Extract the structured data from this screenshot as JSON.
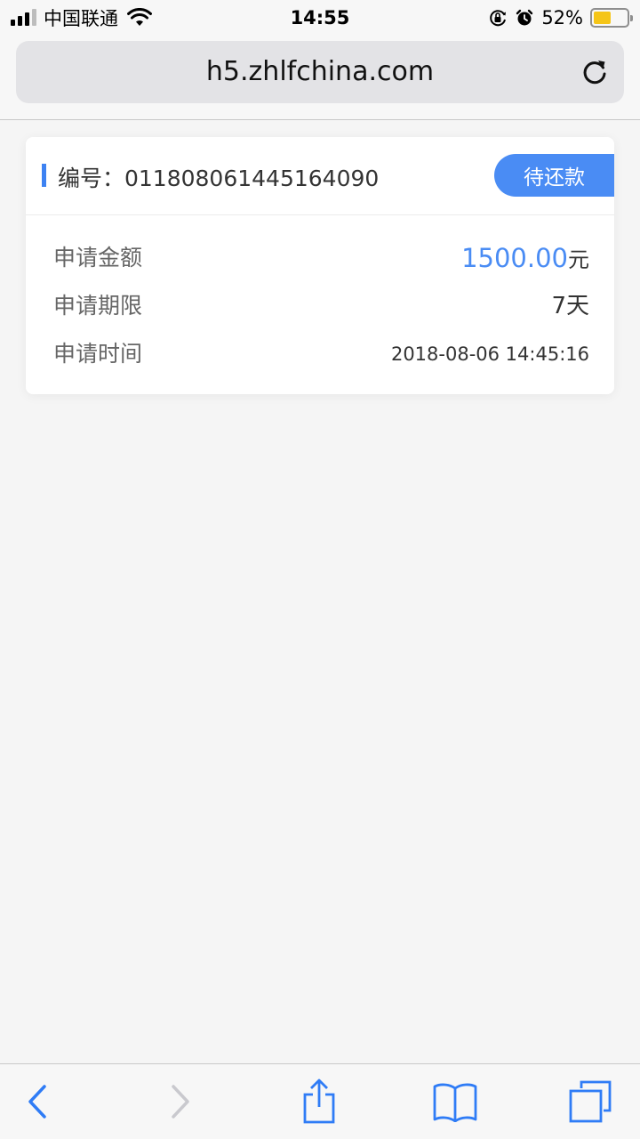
{
  "status_bar": {
    "carrier": "中国联通",
    "time": "14:55",
    "battery_percent": "52%",
    "battery_level": 0.52,
    "battery_color": "#f5c518",
    "signal_bars_active": 3,
    "signal_bars_total": 4
  },
  "browser": {
    "url": "h5.zhlfchina.com"
  },
  "card": {
    "order_label": "编号：011808061445164090",
    "status": "待还款",
    "rows": [
      {
        "label": "申请金额",
        "amount": "1500.00",
        "unit": "元"
      },
      {
        "label": "申请期限",
        "value": "7天"
      },
      {
        "label": "申请时间",
        "value": "2018-08-06 14:45:16"
      }
    ]
  },
  "colors": {
    "accent": "#4a8cf4",
    "background": "#f5f5f5",
    "card": "#ffffff"
  },
  "toolbar": {
    "icons": [
      "back-icon",
      "forward-icon",
      "share-icon",
      "bookmarks-icon",
      "tabs-icon"
    ]
  }
}
